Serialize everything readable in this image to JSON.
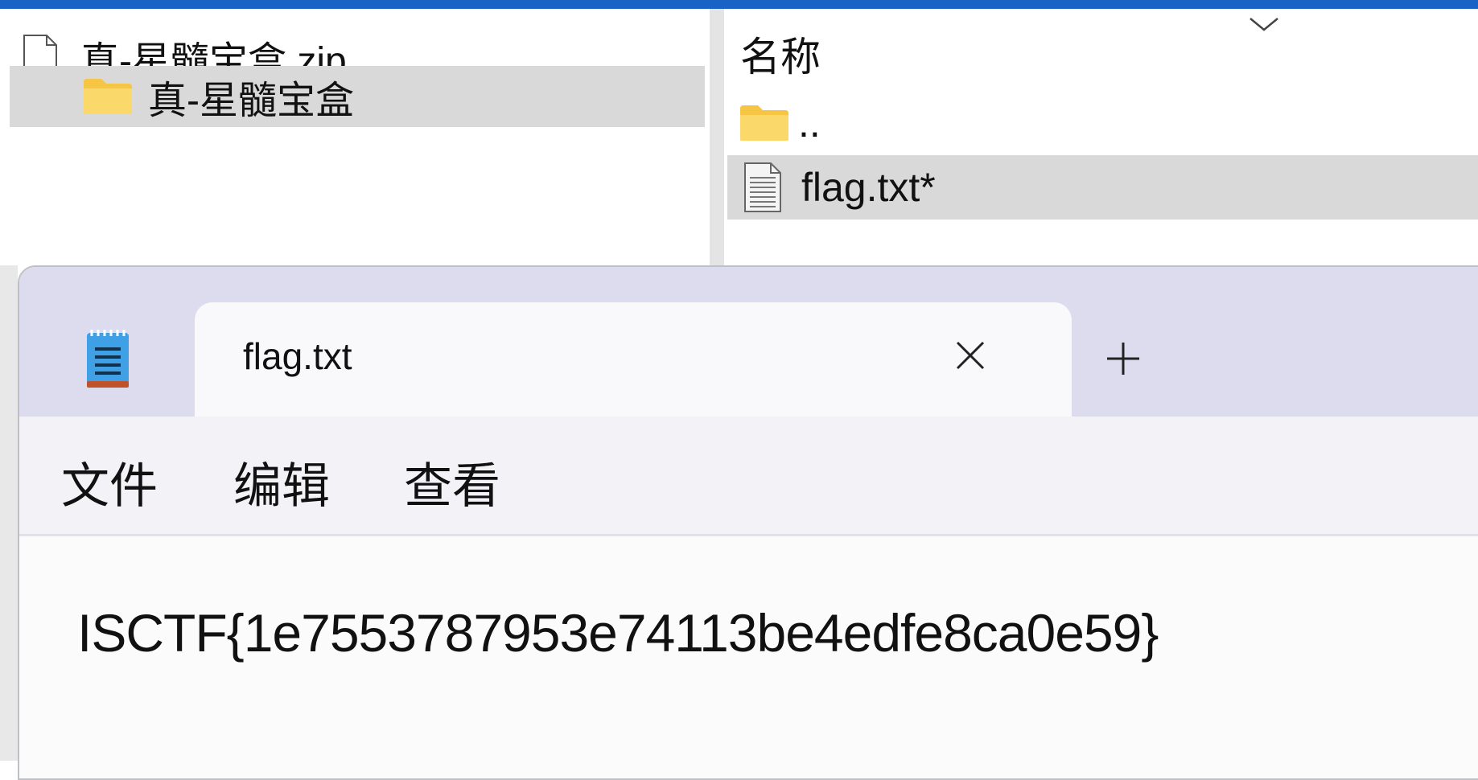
{
  "explorer": {
    "tree": {
      "items": [
        {
          "label": "真-星髓宝盒.zip",
          "icon": "file-icon"
        },
        {
          "label": "真-星髓宝盒",
          "icon": "folder-icon",
          "selected": true
        }
      ]
    },
    "list": {
      "column_header": "名称",
      "items": [
        {
          "label": "..",
          "icon": "folder-icon"
        },
        {
          "label": "flag.txt*",
          "icon": "text-file-icon",
          "selected": true
        }
      ]
    }
  },
  "notepad": {
    "tab_title": "flag.txt",
    "menu": {
      "file": "文件",
      "edit": "编辑",
      "view": "查看"
    },
    "content": "ISCTF{1e7553787953e74113be4edfe8ca0e59}"
  },
  "colors": {
    "accent": "#1a63c6",
    "selection": "#d9d9d9",
    "titlebar": "#dcdcee",
    "folder": "#f6c544"
  }
}
